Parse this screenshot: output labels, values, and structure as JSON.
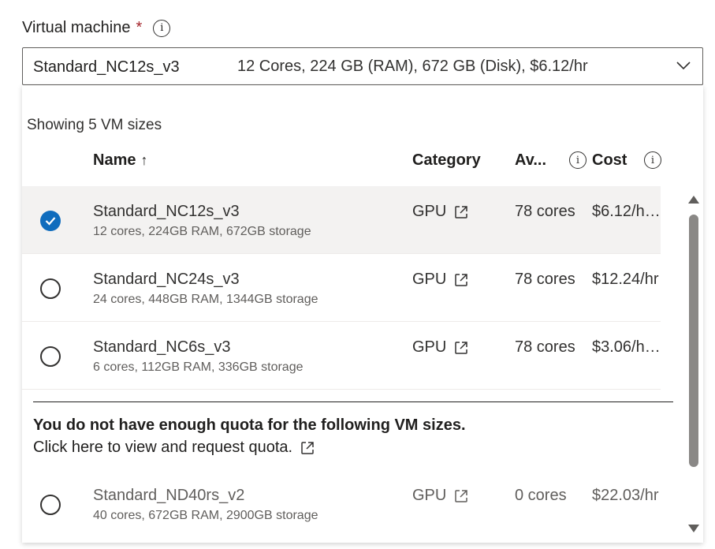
{
  "field": {
    "label": "Virtual machine",
    "required_mark": "*",
    "info_glyph": "i"
  },
  "select": {
    "selected_name": "Standard_NC12s_v3",
    "selected_desc": "12 Cores, 224 GB (RAM), 672 GB (Disk), $6.12/hr"
  },
  "dropdown": {
    "showing_text": "Showing 5 VM sizes",
    "headers": {
      "name": "Name",
      "sort_arrow": "↑",
      "category": "Category",
      "available": "Av...",
      "cost": "Cost"
    },
    "rows": [
      {
        "name": "Standard_NC12s_v3",
        "specs": "12 cores, 224GB RAM, 672GB storage",
        "category": "GPU",
        "available": "78 cores",
        "cost": "$6.12/hr...",
        "selected": true
      },
      {
        "name": "Standard_NC24s_v3",
        "specs": "24 cores, 448GB RAM, 1344GB storage",
        "category": "GPU",
        "available": "78 cores",
        "cost": "$12.24/hr",
        "selected": false
      },
      {
        "name": "Standard_NC6s_v3",
        "specs": "6 cores, 112GB RAM, 336GB storage",
        "category": "GPU",
        "available": "78 cores",
        "cost": "$3.06/hr...",
        "selected": false
      }
    ],
    "quota": {
      "title": "You do not have enough quota for the following VM sizes.",
      "link": "Click here to view and request quota."
    },
    "quota_rows": [
      {
        "name": "Standard_ND40rs_v2",
        "specs": "40 cores, 672GB RAM, 2900GB storage",
        "category": "GPU",
        "available": "0 cores",
        "cost": "$22.03/hr",
        "selected": false
      }
    ]
  },
  "icons": {
    "info": "info-icon",
    "external_link": "external-link-icon",
    "chevron": "chevron-down-icon",
    "check": "checkmark-icon"
  },
  "colors": {
    "accent": "#0f6cbd",
    "required": "#a4262c",
    "selected_row_bg": "#f3f2f1"
  }
}
